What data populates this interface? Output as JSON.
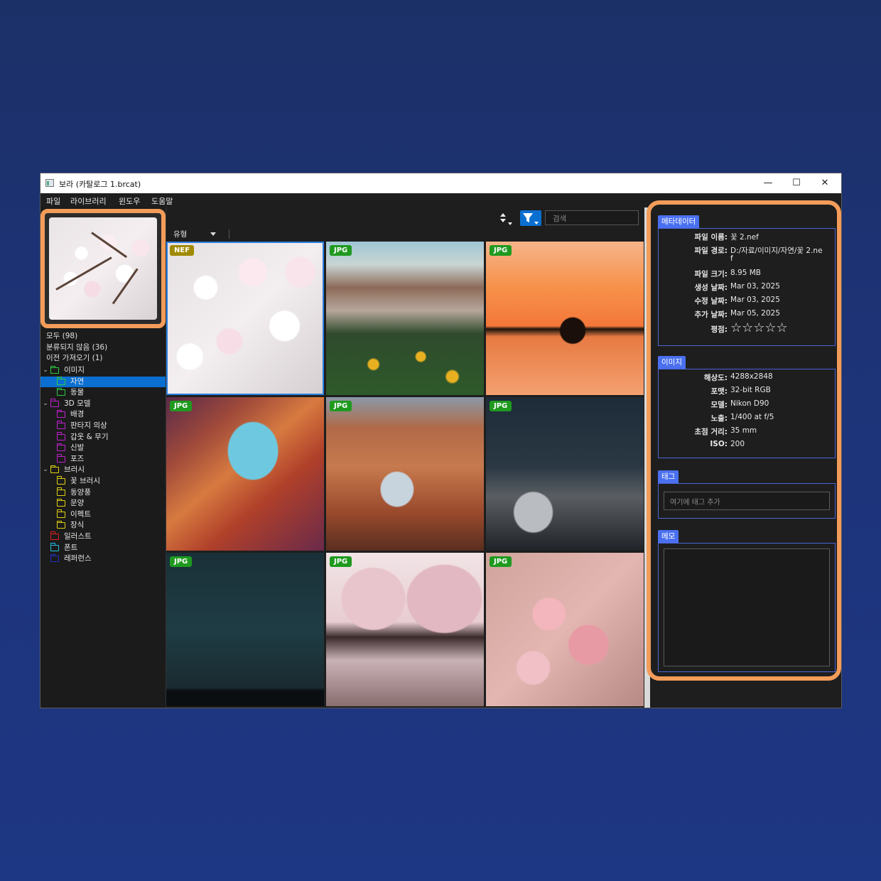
{
  "window": {
    "title": "보라 (카탈로그 1.brcat)",
    "minimize": "—",
    "maximize": "☐",
    "close": "✕"
  },
  "menu": [
    "파일",
    "라이브러리",
    "윈도우",
    "도움말"
  ],
  "library": {
    "all": "모두 (98)",
    "unsorted": "분류되지 않음 (36)",
    "previous_import": "이전 가져오기 (1)"
  },
  "tree": [
    {
      "label": "이미지",
      "color": "#2ecc40",
      "level": 0,
      "expanded": true
    },
    {
      "label": "자연",
      "color": "#2ecc40",
      "level": 1,
      "selected": true
    },
    {
      "label": "동물",
      "color": "#2ecc40",
      "level": 1
    },
    {
      "label": "3D 모델",
      "color": "#c020d0",
      "level": 0,
      "expanded": true
    },
    {
      "label": "배경",
      "color": "#c020d0",
      "level": 1
    },
    {
      "label": "판타지 의상",
      "color": "#c020d0",
      "level": 1
    },
    {
      "label": "갑옷 & 무기",
      "color": "#c020d0",
      "level": 1
    },
    {
      "label": "신발",
      "color": "#c020d0",
      "level": 1
    },
    {
      "label": "포즈",
      "color": "#c020d0",
      "level": 1
    },
    {
      "label": "브러시",
      "color": "#e0d010",
      "level": 0,
      "expanded": true
    },
    {
      "label": "꽃 브러시",
      "color": "#e0d010",
      "level": 1
    },
    {
      "label": "동양풍",
      "color": "#e0d010",
      "level": 1
    },
    {
      "label": "문양",
      "color": "#e0d010",
      "level": 1
    },
    {
      "label": "이펙트",
      "color": "#e0d010",
      "level": 1
    },
    {
      "label": "장식",
      "color": "#e0d010",
      "level": 1
    },
    {
      "label": "일러스트",
      "color": "#e02020",
      "level": 0
    },
    {
      "label": "폰트",
      "color": "#20c0e0",
      "level": 0
    },
    {
      "label": "레퍼런스",
      "color": "#2030c0",
      "level": 0
    }
  ],
  "toolbar": {
    "search_placeholder": "검색",
    "type_filter": "유형"
  },
  "thumbnails": [
    {
      "format": "NEF",
      "subject": "cherry-blossom",
      "selected": true
    },
    {
      "format": "JPG",
      "subject": "mountain-meadow"
    },
    {
      "format": "JPG",
      "subject": "sunset-island"
    },
    {
      "format": "JPG",
      "subject": "canyon"
    },
    {
      "format": "JPG",
      "subject": "rock-arch"
    },
    {
      "format": "JPG",
      "subject": "night-mountain"
    },
    {
      "format": "JPG",
      "subject": "starry-sky"
    },
    {
      "format": "JPG",
      "subject": "blossom-trees-reflection"
    },
    {
      "format": "JPG",
      "subject": "pink-blossom"
    }
  ],
  "metadata": {
    "section": "메타데이터",
    "rows": [
      {
        "key": "파일 이름:",
        "value": "꽃 2.nef"
      },
      {
        "key": "파일 경로:",
        "value": "D:/자료/이미지/자연/꽃 2.ne",
        "value2": "f"
      },
      {
        "key": "파일 크기:",
        "value": "8.95 MB"
      },
      {
        "key": "생성 날짜:",
        "value": "Mar 03, 2025"
      },
      {
        "key": "수정 날짜:",
        "value": "Mar 03, 2025"
      },
      {
        "key": "추가 날짜:",
        "value": "Mar 05, 2025"
      },
      {
        "key": "평점:",
        "value": "☆☆☆☆☆"
      }
    ],
    "rating": 0
  },
  "image_info": {
    "section": "이미지",
    "rows": [
      {
        "key": "해상도:",
        "value": "4288x2848"
      },
      {
        "key": "포맷:",
        "value": "32-bit RGB"
      },
      {
        "key": "모델:",
        "value": "Nikon D90"
      },
      {
        "key": "노출:",
        "value": "1/400 at f/5"
      },
      {
        "key": "초점 거리:",
        "value": "35 mm"
      },
      {
        "key": "ISO:",
        "value": "200"
      }
    ]
  },
  "tags": {
    "section": "태그",
    "placeholder": "여기에 태그 추가"
  },
  "memo": {
    "section": "메모",
    "value": ""
  },
  "colors": {
    "accent": "#0b6fd1",
    "highlight": "#f39c5a",
    "section_tab": "#4a70f0",
    "badge_jpg": "#1f9a1f",
    "badge_nef": "#a08a00"
  }
}
